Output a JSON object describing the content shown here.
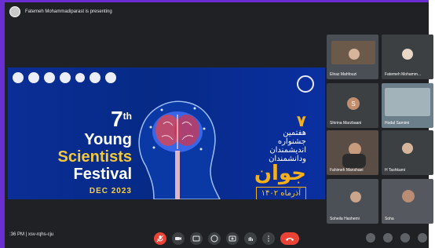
{
  "presenting": {
    "text": "Fatemeh Mohammadiparast is presenting"
  },
  "slide": {
    "number": "7",
    "ordinal_suffix": "th",
    "line1": "Young",
    "line2": "Scientists",
    "line3": "Festival",
    "date_month": "DEC",
    "date_year": "2023",
    "fa_top": "هفتمین",
    "fa_middle": "جشنواره",
    "fa_middle2": "اندیشمندان",
    "fa_middle3": "ودانشمندان",
    "fa_big": "جوان",
    "fa_date": "آذرماه ۱۴۰۲"
  },
  "participants": [
    {
      "name": "Elnaz Mahfouzi"
    },
    {
      "name": "Fatemeh Mohamm..."
    },
    {
      "name": "Shirina Marzbaani"
    },
    {
      "name": "Hodal Samimi"
    },
    {
      "name": "Fahimeh Manshaei"
    },
    {
      "name": "H Tashkami"
    },
    {
      "name": "Soheila Hashemi"
    },
    {
      "name": "Soha"
    }
  ],
  "bottom": {
    "time": ":36 PM",
    "meeting_code": "xsv-rqhs-cju"
  },
  "colors": {
    "accent": "#6a2fd0",
    "slide_bg": "#0a2e96",
    "gold": "#f6b01a",
    "red": "#ea4335"
  }
}
